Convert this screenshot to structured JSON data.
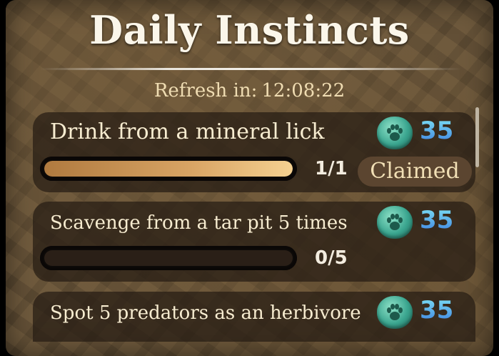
{
  "header": {
    "title": "Daily Instincts",
    "refresh_label": "Refresh in:",
    "refresh_time": "12:08:22"
  },
  "quests": [
    {
      "label": "Drink from a mineral lick",
      "reward": "35",
      "reward_icon": "paw-token-icon",
      "progress_text": "1/1",
      "progress": 1.0,
      "status": "Claimed"
    },
    {
      "label": "Scavenge from a tar pit 5 times",
      "reward": "35",
      "reward_icon": "paw-token-icon",
      "progress_text": "0/5",
      "progress": 0.0
    },
    {
      "label": "Spot 5 predators as an herbivore",
      "reward": "35",
      "reward_icon": "paw-token-icon"
    }
  ],
  "colors": {
    "title": "#fbf6ea",
    "refresh": "#efdcb2",
    "reward_number": "#4aa6e8",
    "progress_fill": "#d9a565",
    "claimed_bg": "#5b4530"
  }
}
